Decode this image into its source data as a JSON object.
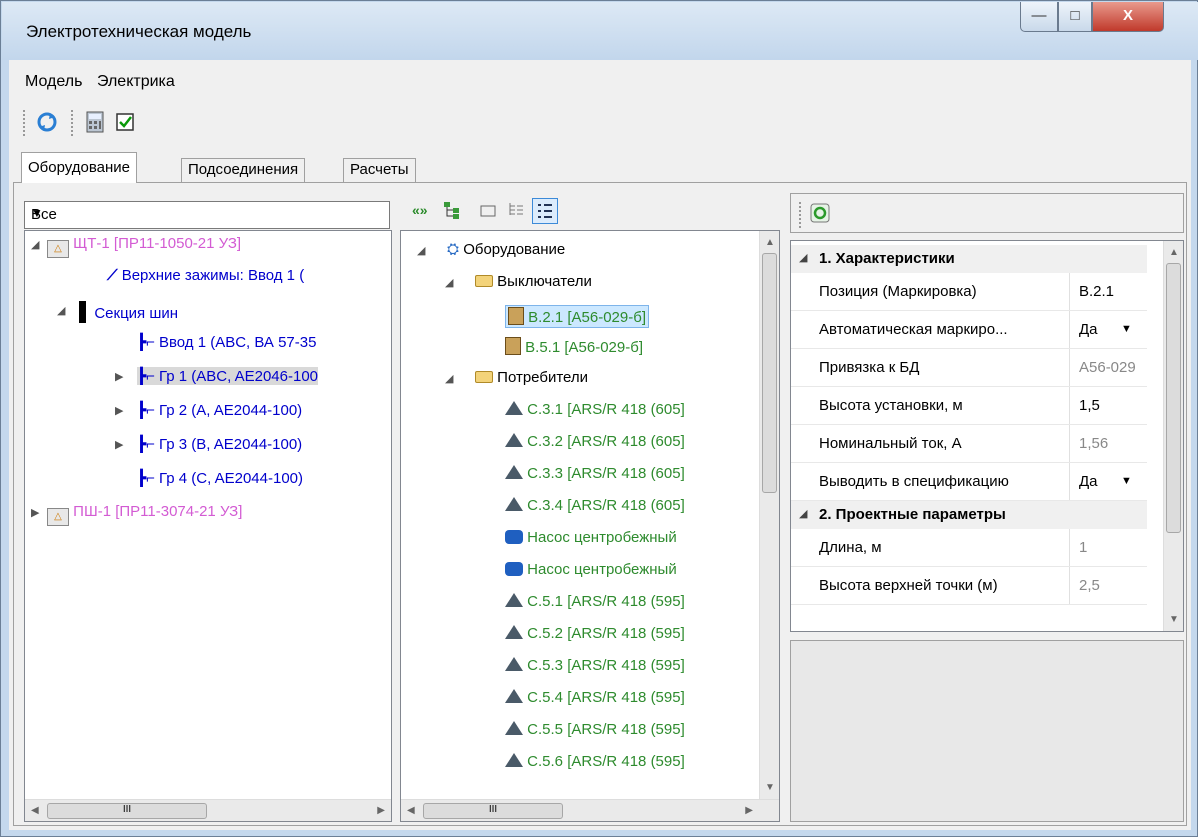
{
  "window": {
    "title": "Электротехническая модель",
    "min": "—",
    "max": "□",
    "close": "X"
  },
  "menu": [
    "Модель",
    "Электрика"
  ],
  "tabs": [
    "Оборудование",
    "Подсоединения",
    "Расчеты"
  ],
  "filter": {
    "value": "Все"
  },
  "tree_left": [
    {
      "label": "ЩТ-1 [ПР11-1050-21 УЗ]",
      "color": "#d35bd3"
    },
    {
      "label": "Верхние зажимы: Ввод  1 (",
      "color": "#0000cc"
    },
    {
      "label": "Секция шин",
      "color": "#0000cc"
    },
    {
      "label": "Ввод  1 (ABC, ВА 57-35",
      "color": "#0000cc"
    },
    {
      "label": "Гр  1 (ABC, AE2046-100",
      "color": "#0000cc"
    },
    {
      "label": "Гр  2 (A, AE2044-100)",
      "color": "#0000cc"
    },
    {
      "label": "Гр  3 (B, AE2044-100)",
      "color": "#0000cc"
    },
    {
      "label": "Гр  4 (C, AE2044-100)",
      "color": "#0000cc"
    },
    {
      "label": "ПШ-1 [ПР11-3074-21 УЗ]",
      "color": "#d35bd3"
    }
  ],
  "tree_mid": [
    {
      "label": "Оборудование",
      "color": "#000"
    },
    {
      "label": "Выключатели",
      "color": "#000"
    },
    {
      "label": "В.2.1 [А56-029-б]",
      "color": "#2e8b2e"
    },
    {
      "label": "В.5.1 [А56-029-б]",
      "color": "#2e8b2e"
    },
    {
      "label": "Потребители",
      "color": "#000"
    },
    {
      "label": "С.3.1 [ARS/R 418 (605]",
      "color": "#2e8b2e"
    },
    {
      "label": "С.3.2 [ARS/R 418 (605]",
      "color": "#2e8b2e"
    },
    {
      "label": "С.3.3 [ARS/R 418 (605]",
      "color": "#2e8b2e"
    },
    {
      "label": "С.3.4 [ARS/R 418 (605]",
      "color": "#2e8b2e"
    },
    {
      "label": "Насос центробежный",
      "color": "#2e8b2e"
    },
    {
      "label": "Насос центробежный",
      "color": "#2e8b2e"
    },
    {
      "label": "С.5.1 [ARS/R 418 (595]",
      "color": "#2e8b2e"
    },
    {
      "label": "С.5.2 [ARS/R 418 (595]",
      "color": "#2e8b2e"
    },
    {
      "label": "С.5.3 [ARS/R 418 (595]",
      "color": "#2e8b2e"
    },
    {
      "label": "С.5.4 [ARS/R 418 (595]",
      "color": "#2e8b2e"
    },
    {
      "label": "С.5.5 [ARS/R 418 (595]",
      "color": "#2e8b2e"
    },
    {
      "label": "С.5.6 [ARS/R 418 (595]",
      "color": "#2e8b2e"
    }
  ],
  "props": {
    "cat1": "1. Характеристики",
    "rows1": [
      {
        "name": "Позиция (Маркировка)",
        "value": "В.2.1",
        "gray": false,
        "dd": false
      },
      {
        "name": "Автоматическая маркиро...",
        "value": "Да",
        "gray": false,
        "dd": true
      },
      {
        "name": "Привязка к БД",
        "value": "А56-029",
        "gray": true,
        "dd": false
      },
      {
        "name": "Высота установки, м",
        "value": "1,5",
        "gray": false,
        "dd": false
      },
      {
        "name": "Номинальный ток, А",
        "value": "1,56",
        "gray": true,
        "dd": false
      },
      {
        "name": "Выводить в спецификацию",
        "value": "Да",
        "gray": false,
        "dd": true
      }
    ],
    "cat2": "2. Проектные параметры",
    "rows2": [
      {
        "name": "Длина, м",
        "value": "1",
        "gray": true,
        "dd": false
      },
      {
        "name": "Высота верхней точки (м)",
        "value": "2,5",
        "gray": true,
        "dd": false
      }
    ]
  },
  "scroll_label": "III",
  "colors": {
    "accent_select": "#cce8ff",
    "left_select": "#d9d9d9"
  }
}
